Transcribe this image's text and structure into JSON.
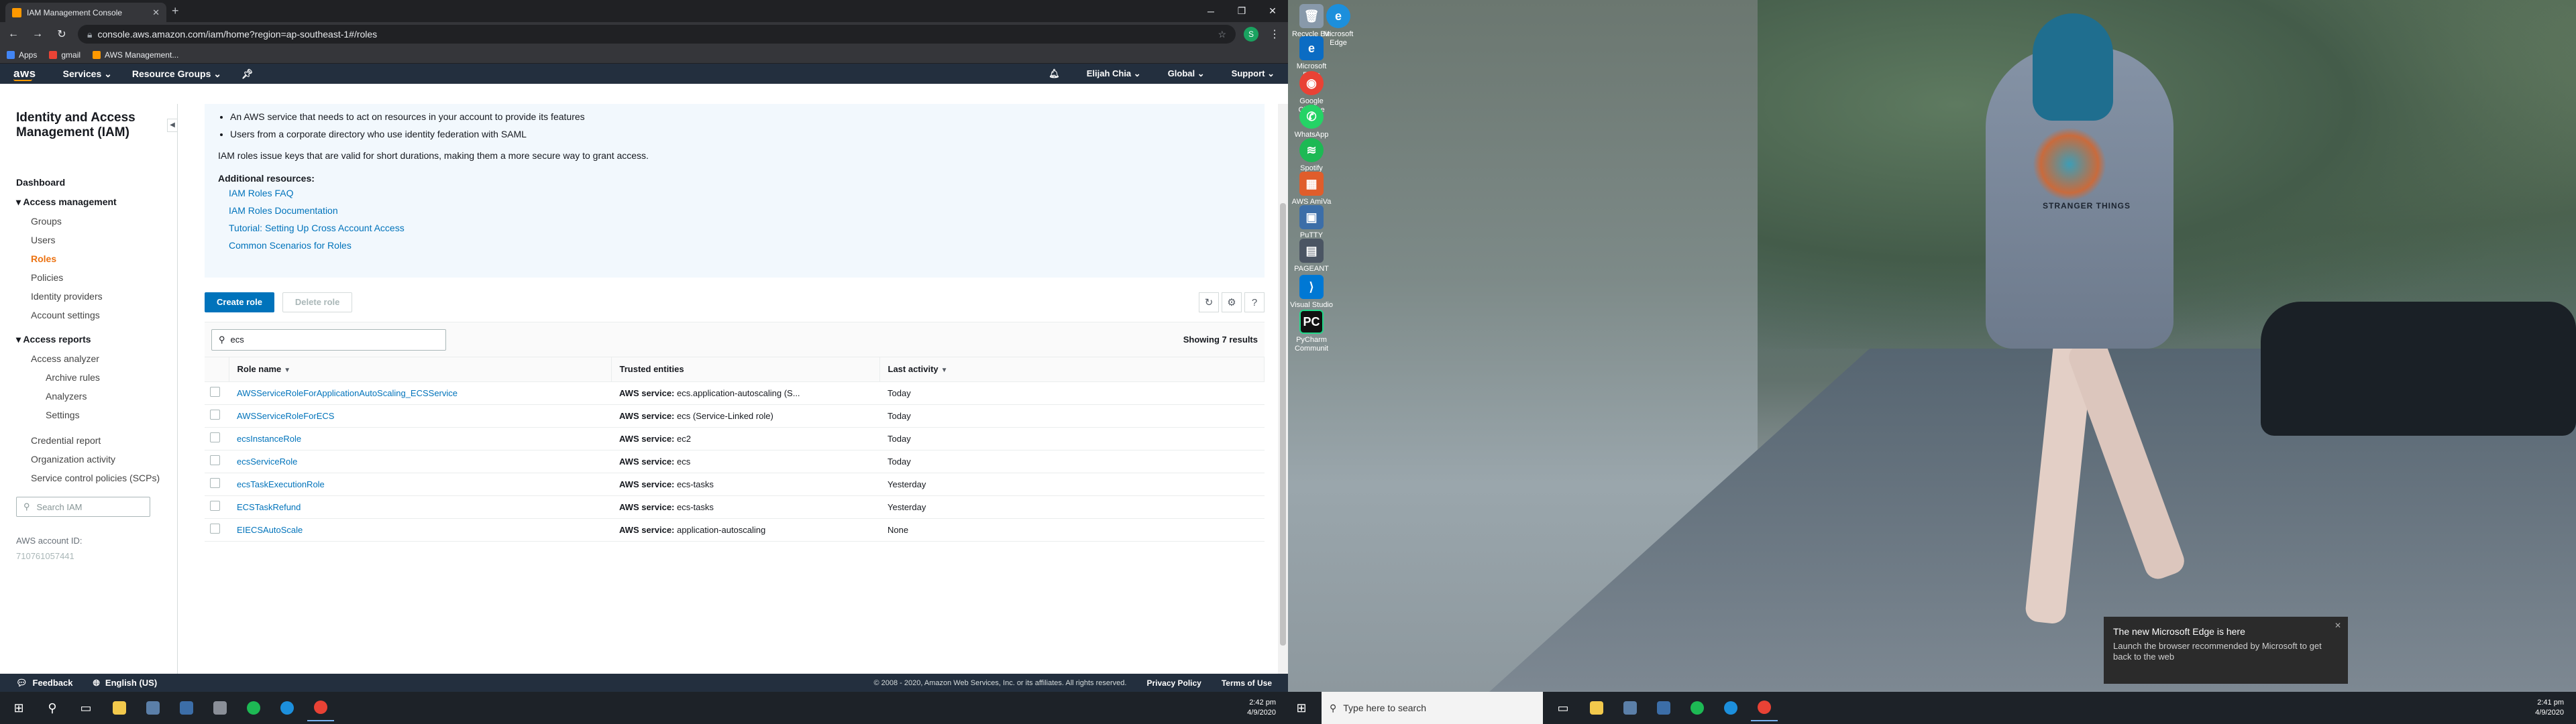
{
  "browser": {
    "tab_title": "IAM Management Console",
    "url": "console.aws.amazon.com/iam/home?region=ap-southeast-1#/roles",
    "profile_initial": "S",
    "bookmarks": [
      "Apps",
      "gmail",
      "AWS Management..."
    ]
  },
  "aws": {
    "logo": "aws",
    "services": "Services",
    "resource_groups": "Resource Groups",
    "user": "Elijah Chia",
    "region": "Global",
    "support": "Support"
  },
  "sidebar": {
    "title": "Identity and Access Management (IAM)",
    "dashboard": "Dashboard",
    "access_management": "Access management",
    "am_items": [
      "Groups",
      "Users",
      "Roles",
      "Policies",
      "Identity providers",
      "Account settings"
    ],
    "access_reports": "Access reports",
    "ar_items": [
      "Access analyzer"
    ],
    "analyzer_items": [
      "Archive rules",
      "Analyzers",
      "Settings"
    ],
    "ar_more": [
      "Credential report",
      "Organization activity",
      "Service control policies (SCPs)"
    ],
    "search_placeholder": "Search IAM",
    "account_label": "AWS account ID:",
    "account_id": "710761057441"
  },
  "info": {
    "bullets": [
      "An AWS service that needs to act on resources in your account to provide its features",
      "Users from a corporate directory who use identity federation with SAML"
    ],
    "note": "IAM roles issue keys that are valid for short durations, making them a more secure way to grant access.",
    "additional": "Additional resources:",
    "links": [
      "IAM Roles FAQ",
      "IAM Roles Documentation",
      "Tutorial: Setting Up Cross Account Access",
      "Common Scenarios for Roles"
    ]
  },
  "actions": {
    "create": "Create role",
    "delete": "Delete role"
  },
  "table": {
    "filter_value": "ecs",
    "showing": "Showing 7 results",
    "headers": [
      "Role name",
      "Trusted entities",
      "Last activity"
    ],
    "trust_prefix": "AWS service:",
    "rows": [
      {
        "name": "AWSServiceRoleForApplicationAutoScaling_ECSService",
        "trusted": "ecs.application-autoscaling (S...",
        "last": "Today"
      },
      {
        "name": "AWSServiceRoleForECS",
        "trusted": "ecs (Service-Linked role)",
        "last": "Today"
      },
      {
        "name": "ecsInstanceRole",
        "trusted": "ec2",
        "last": "Today"
      },
      {
        "name": "ecsServiceRole",
        "trusted": "ecs",
        "last": "Today"
      },
      {
        "name": "ecsTaskExecutionRole",
        "trusted": "ecs-tasks",
        "last": "Yesterday"
      },
      {
        "name": "ECSTaskRefund",
        "trusted": "ecs-tasks",
        "last": "Yesterday"
      },
      {
        "name": "EIECSAutoScale",
        "trusted": "application-autoscaling",
        "last": "None"
      }
    ]
  },
  "footer": {
    "feedback": "Feedback",
    "language": "English (US)",
    "copyright": "© 2008 - 2020, Amazon Web Services, Inc. or its affiliates. All rights reserved.",
    "privacy": "Privacy Policy",
    "terms": "Terms of Use"
  },
  "taskbar_left": {
    "time": "2:42 pm",
    "date": "4/9/2020"
  },
  "taskbar_right": {
    "search_placeholder": "Type here to search",
    "time": "2:41 pm",
    "date": "4/9/2020"
  },
  "desktop_icons": [
    "Recycle Bin",
    "Microsoft Edge",
    "Microsoft Edge",
    "Google Chrome",
    "WhatsApp",
    "Spotify",
    "AWS AmiVa",
    "PuTTY",
    "PAGEANT",
    "Visual Studio Code",
    "PyCharm Communit"
  ],
  "wallpaper": {
    "print_text": "STRANGER THINGS"
  },
  "toast": {
    "title": "The new Microsoft Edge is here",
    "body": "Launch the browser recommended by Microsoft to get back to the web"
  }
}
